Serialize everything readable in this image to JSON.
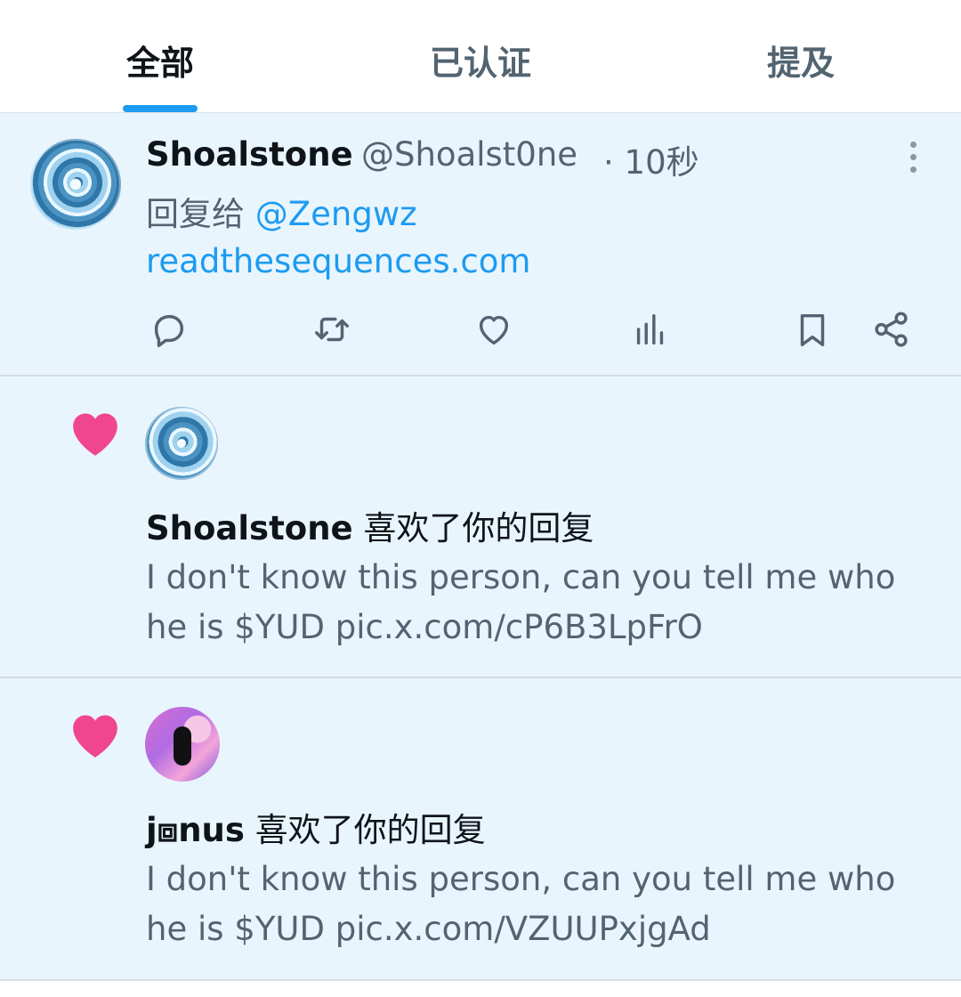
{
  "tabs": [
    {
      "label": "全部",
      "active": true
    },
    {
      "label": "已认证",
      "active": false
    },
    {
      "label": "提及",
      "active": false
    }
  ],
  "post": {
    "name": "Shoalstone",
    "handle": "@Shoalst0ne",
    "time": "· 10秒",
    "reply_prefix": "回复给",
    "reply_mention": "@Zengwz",
    "link": "readthesequences.com",
    "actions": [
      "reply-icon",
      "retweet-icon",
      "like-icon",
      "views-icon",
      "bookmark-icon",
      "share-icon"
    ]
  },
  "notifications": [
    {
      "name": "Shoalstone",
      "action_text": "喜欢了你的回复",
      "text": "I don't know this person, can you tell me who he is $YUD pic.x.com/cP6B3LpFrO",
      "text_line1": "I don't know this person, can you tell me who",
      "text_line2": "he is $YUD pic.x.com/cP6B3LpFrO"
    },
    {
      "name": "j⧈nus",
      "action_text": "喜欢了你的回复",
      "text": "I don't know this person, can you tell me who he is $YUD pic.x.com/VZUUPxjgAd",
      "text_line1": "I don't know this person, can you tell me who",
      "text_line2": "he is $YUD pic.x.com/VZUUPxjgAd"
    }
  ],
  "colors": {
    "accent": "#1d9bf0",
    "like_pink": "#f0468f",
    "section_bg": "#e9f5fd",
    "muted_text": "#536471"
  }
}
